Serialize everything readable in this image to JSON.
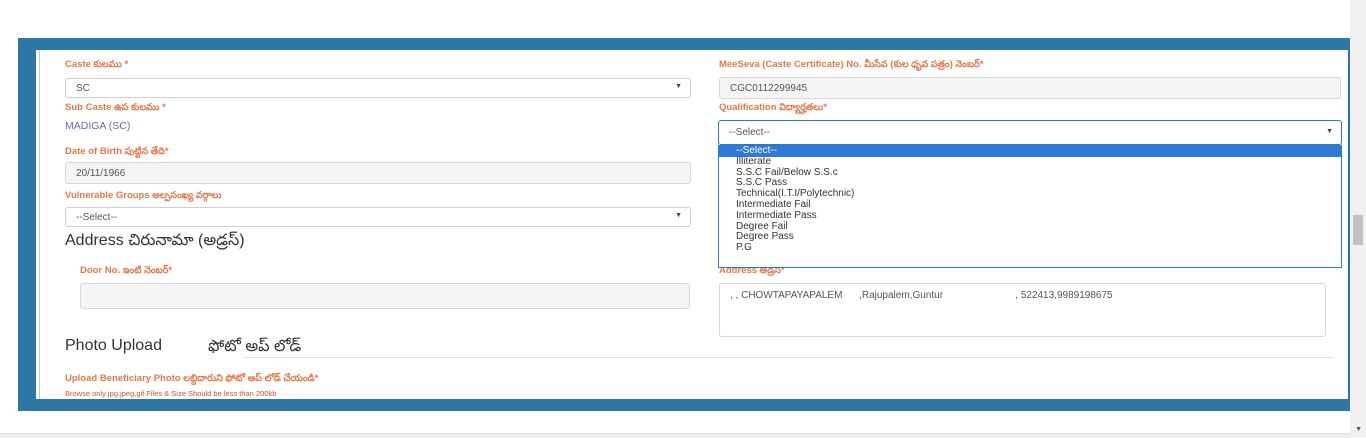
{
  "form": {
    "caste": {
      "label": "Caste కులము",
      "required": "*",
      "value": "SC"
    },
    "meeseva": {
      "label": "MeeSeva (Caste Certificate) No. మీసేవ (కుల ధృవ పత్రం) నెంబర్",
      "required": "*",
      "value": "CGC0112299945"
    },
    "sub_caste": {
      "label": "Sub Caste ఉప కులము",
      "required": "*",
      "value": "MADIGA (SC)"
    },
    "qualification": {
      "label": "Qualification విద్యార్హతలు",
      "required": "*",
      "value": "--Select--",
      "options": [
        "--Select--",
        "Illiterate",
        "S.S.C Fail/Below S.S.c",
        "S.S.C Pass",
        "Technical(I.T.I/Polytechnic)",
        "Intermediate Fail",
        "Intermediate Pass",
        "Degree Fail",
        "Degree Pass",
        "P.G"
      ]
    },
    "dob": {
      "label": "Date of Birth పుట్టిన తేది",
      "required": "*",
      "value": "20/11/1966"
    },
    "vulnerable": {
      "label": "Vulnerable Groups అల్పసంఖ్య వర్గాలు",
      "value": "--Select--"
    },
    "address_heading": "Address చిరునామా (అడ్రస్)",
    "door": {
      "label": "Door No. ఇంటి నెంబర్",
      "required": "*",
      "value": ""
    },
    "address": {
      "label": "Address అడ్రస్",
      "required": "*",
      "value": ", , CHOWTAPAYAPALEM      ,Rajupalem,Guntur                          , 522413,9989198675"
    },
    "photo_heading": "Photo Upload",
    "photo_heading_te": "ఫోటో అప్ లోడ్",
    "upload": {
      "label": "Upload Beneficiary Photo లబ్దిదారుని ఫోటో అప్ లోడ్ చేయండి",
      "required": "*",
      "note": "Browse only jpg,jpeg,gif Files & Size Should be less than 200kb"
    }
  },
  "colors": {
    "frame": "#2e77a4",
    "label": "#e8784a",
    "selected_option": "#2e7bd6",
    "static_value": "#7b5fbd"
  }
}
